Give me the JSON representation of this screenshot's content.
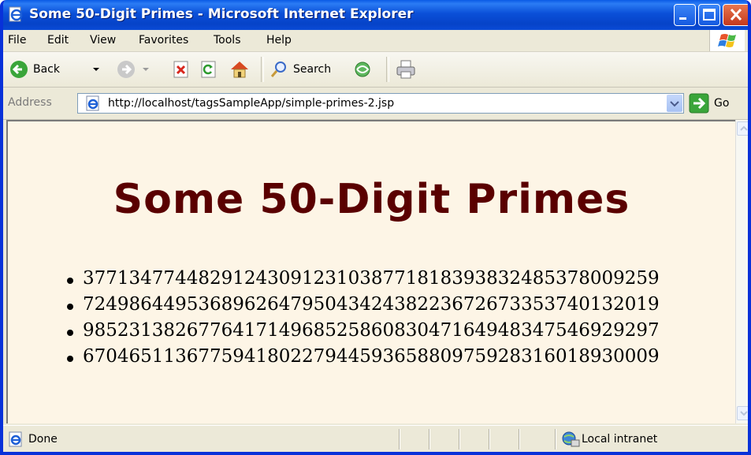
{
  "window": {
    "title": "Some 50-Digit Primes - Microsoft Internet Explorer"
  },
  "menu": [
    "File",
    "Edit",
    "View",
    "Favorites",
    "Tools",
    "Help"
  ],
  "toolbar": {
    "back_label": "Back",
    "search_label": "Search"
  },
  "address": {
    "label": "Address",
    "url": "http://localhost/tagsSampleApp/simple-primes-2.jsp",
    "go_label": "Go"
  },
  "page": {
    "heading": "Some 50-Digit Primes",
    "primes": [
      "37713477448291243091231038771818393832485378009259",
      "72498644953689626479504342438223672673353740132019",
      "98523138267764171496852586083047164948347546929297",
      "67046511367759418022794459365880975928316018930009"
    ]
  },
  "status": {
    "text": "Done",
    "zone": "Local intranet"
  },
  "colors": {
    "title_bar": "#0a4fd8",
    "page_background": "#fdf5e6",
    "heading": "#5a0000"
  },
  "icons": [
    "ie-page-icon",
    "minimize-icon",
    "maximize-icon",
    "close-icon",
    "windows-flag-icon",
    "back-arrow-icon",
    "forward-arrow-icon",
    "stop-icon",
    "refresh-icon",
    "home-icon",
    "search-icon",
    "favorites-icon",
    "print-icon",
    "go-arrow-icon",
    "local-intranet-icon"
  ]
}
